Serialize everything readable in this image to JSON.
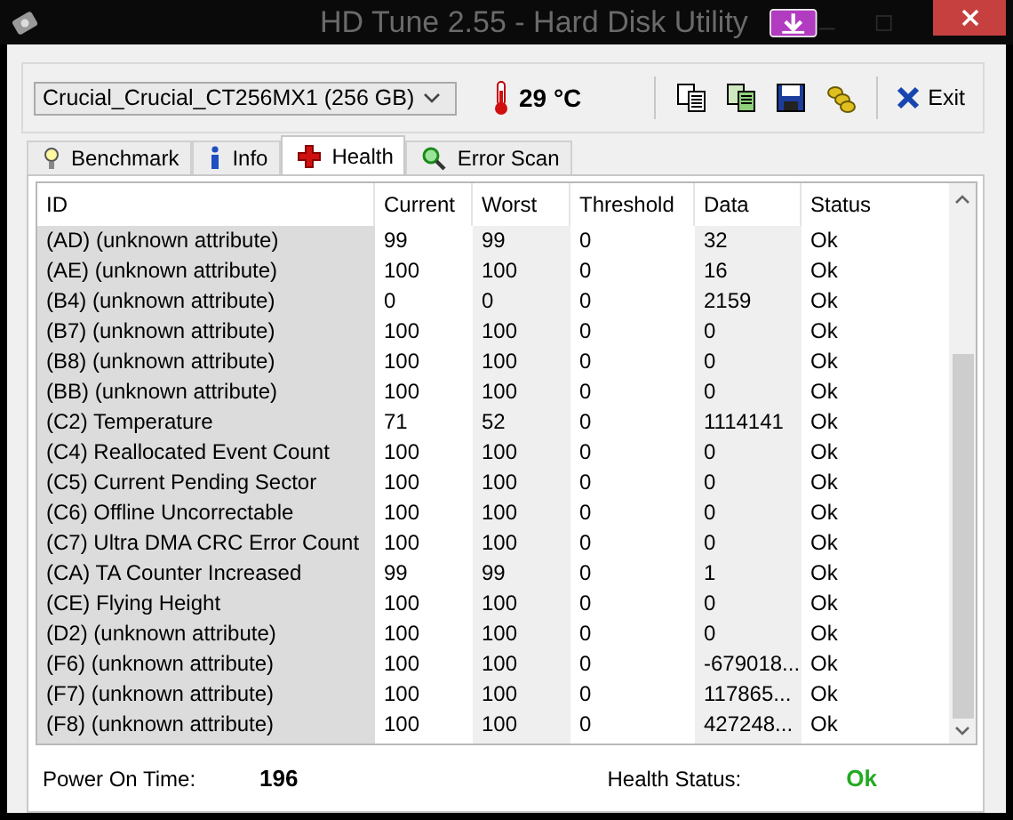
{
  "window": {
    "title": "HD Tune 2.55 - Hard Disk Utility"
  },
  "drive_select": {
    "value": "Crucial_Crucial_CT256MX1 (256 GB)"
  },
  "temperature": "29 °C",
  "exit_button": {
    "label": "Exit"
  },
  "tabs": [
    {
      "label": "Benchmark",
      "selected": false
    },
    {
      "label": "Info",
      "selected": false
    },
    {
      "label": "Health",
      "selected": true
    },
    {
      "label": "Error Scan",
      "selected": false
    }
  ],
  "table": {
    "columns": [
      "ID",
      "Current",
      "Worst",
      "Threshold",
      "Data",
      "Status"
    ],
    "rows": [
      [
        "(AD) (unknown attribute)",
        "99",
        "99",
        "0",
        "32",
        "Ok"
      ],
      [
        "(AE) (unknown attribute)",
        "100",
        "100",
        "0",
        "16",
        "Ok"
      ],
      [
        "(B4) (unknown attribute)",
        "0",
        "0",
        "0",
        "2159",
        "Ok"
      ],
      [
        "(B7) (unknown attribute)",
        "100",
        "100",
        "0",
        "0",
        "Ok"
      ],
      [
        "(B8) (unknown attribute)",
        "100",
        "100",
        "0",
        "0",
        "Ok"
      ],
      [
        "(BB) (unknown attribute)",
        "100",
        "100",
        "0",
        "0",
        "Ok"
      ],
      [
        "(C2) Temperature",
        "71",
        "52",
        "0",
        "1114141",
        "Ok"
      ],
      [
        "(C4) Reallocated Event Count",
        "100",
        "100",
        "0",
        "0",
        "Ok"
      ],
      [
        "(C5) Current Pending Sector",
        "100",
        "100",
        "0",
        "0",
        "Ok"
      ],
      [
        "(C6) Offline Uncorrectable",
        "100",
        "100",
        "0",
        "0",
        "Ok"
      ],
      [
        "(C7) Ultra DMA CRC Error Count",
        "100",
        "100",
        "0",
        "0",
        "Ok"
      ],
      [
        "(CA) TA Counter Increased",
        "99",
        "99",
        "0",
        "1",
        "Ok"
      ],
      [
        "(CE) Flying Height",
        "100",
        "100",
        "0",
        "0",
        "Ok"
      ],
      [
        "(D2) (unknown attribute)",
        "100",
        "100",
        "0",
        "0",
        "Ok"
      ],
      [
        "(F6) (unknown attribute)",
        "100",
        "100",
        "0",
        "-679018...",
        "Ok"
      ],
      [
        "(F7) (unknown attribute)",
        "100",
        "100",
        "0",
        "117865...",
        "Ok"
      ],
      [
        "(F8) (unknown attribute)",
        "100",
        "100",
        "0",
        "427248...",
        "Ok"
      ]
    ]
  },
  "power_on_time": {
    "label": "Power On Time:",
    "value": "196"
  },
  "health_status": {
    "label": "Health Status:",
    "value": "Ok"
  }
}
